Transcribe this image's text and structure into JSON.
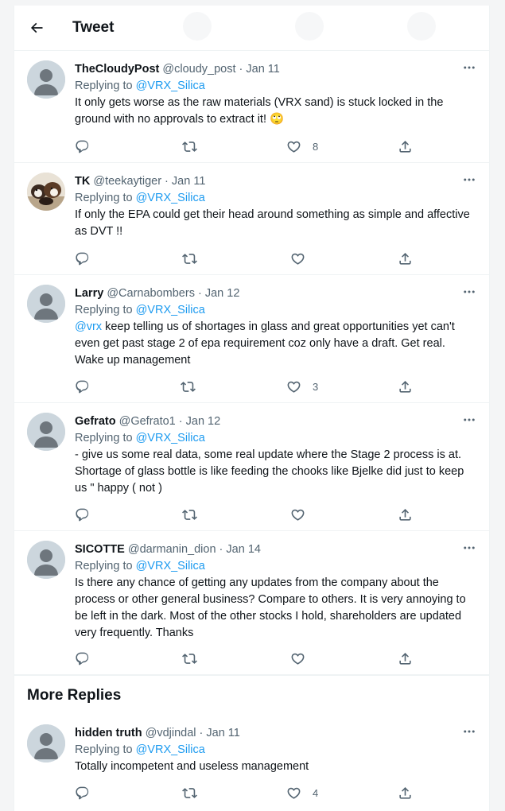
{
  "header": {
    "title": "Tweet"
  },
  "tweets": [
    {
      "name": "TheCloudyPost",
      "handle": "@cloudy_post",
      "date": "Jan 11",
      "replying_label": "Replying to",
      "replying_handle": "@VRX_Silica",
      "text": "It only gets worse as the raw materials (VRX sand) is stuck locked in the ground with no approvals to extract it!",
      "emoji": "🙄",
      "likes": "8"
    },
    {
      "name": "TK",
      "handle": "@teekaytiger",
      "date": "Jan 11",
      "replying_label": "Replying to",
      "replying_handle": "@VRX_Silica",
      "text": "If only the EPA could get their head around something as simple and affective as DVT !!",
      "likes": ""
    },
    {
      "name": "Larry",
      "handle": "@Carnabombers",
      "date": "Jan 12",
      "replying_label": "Replying to",
      "replying_handle": "@VRX_Silica",
      "mention": "@vrx",
      "text": " keep telling us of shortages in glass and great opportunities yet can't even get past stage 2 of epa requirement coz only have a draft. Get real. Wake up management",
      "likes": "3"
    },
    {
      "name": "Gefrato",
      "handle": "@Gefrato1",
      "date": "Jan 12",
      "replying_label": "Replying to",
      "replying_handle": "@VRX_Silica",
      "text": "- give us some real data, some real update where the Stage 2 process is at. Shortage of glass bottle is like feeding the chooks like Bjelke did just to keep us \" happy ( not )",
      "likes": ""
    },
    {
      "name": "SICOTTE",
      "handle": "@darmanin_dion",
      "date": "Jan 14",
      "replying_label": "Replying to",
      "replying_handle": "@VRX_Silica",
      "text": "Is there any chance of getting any updates from the company about the process or other general business? Compare to others. It is very annoying to be left in the dark. Most of the other stocks I hold, shareholders are updated very frequently. Thanks",
      "likes": ""
    }
  ],
  "more_replies": {
    "title": "More Replies",
    "tweet": {
      "name": "hidden truth",
      "handle": "@vdjindal",
      "date": "Jan 11",
      "replying_label": "Replying to",
      "replying_handle": "@VRX_Silica",
      "text": "Totally incompetent and useless management",
      "likes": "4"
    }
  },
  "meta_separator": " · ",
  "icons": {
    "back": "arrow-left-icon",
    "more": "more-dots-icon",
    "reply": "reply-icon",
    "retweet": "retweet-icon",
    "like": "heart-icon",
    "share": "share-icon"
  },
  "colors": {
    "text": "#0f1419",
    "secondary": "#536471",
    "link": "#1d9bf0"
  }
}
